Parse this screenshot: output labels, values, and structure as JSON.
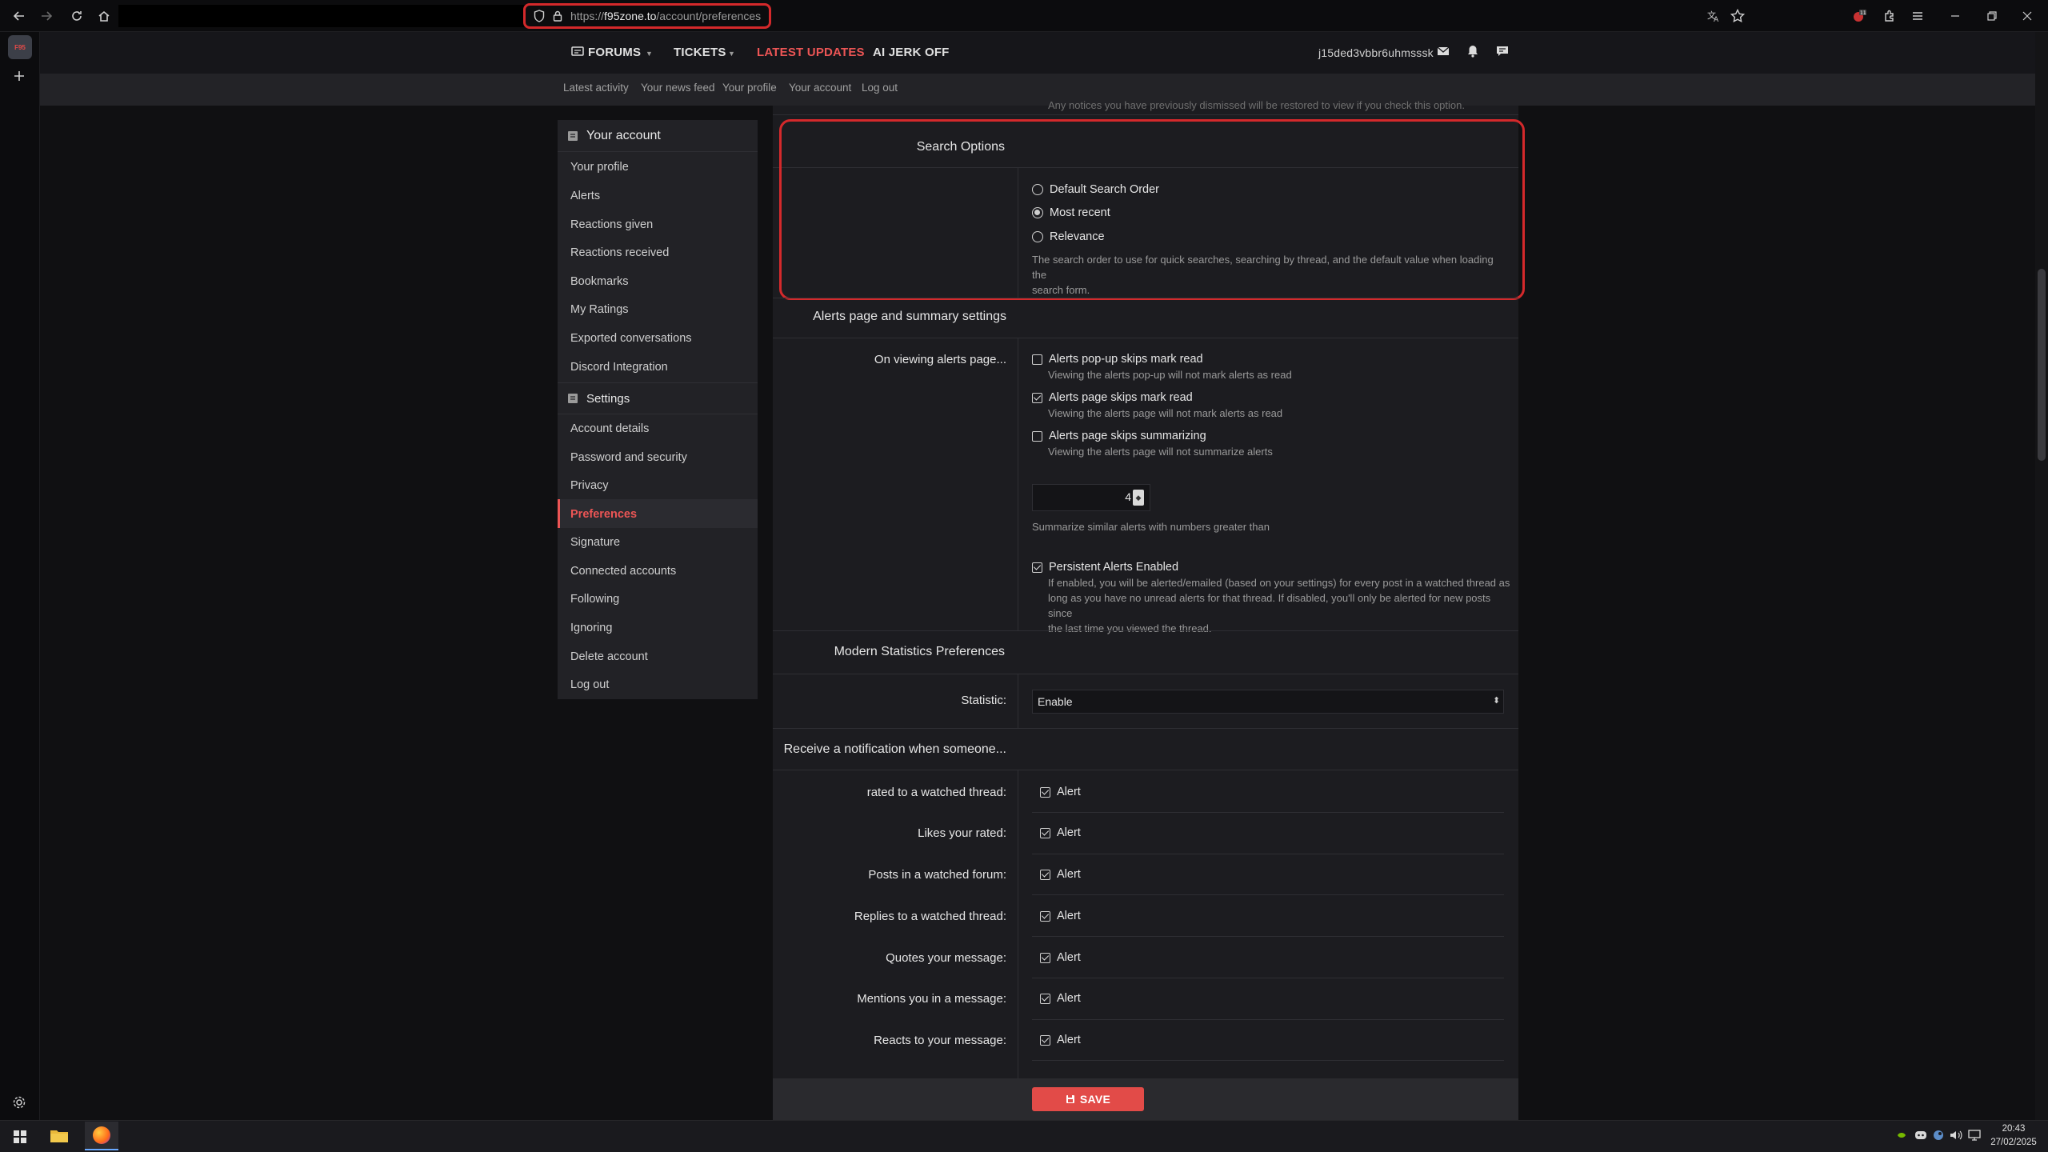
{
  "browser": {
    "url_prefix": "https://",
    "url_host": "f95zone.to",
    "url_path": "/account/preferences"
  },
  "site": {
    "logo_text": "F95",
    "nav": {
      "forums": "FORUMS",
      "tickets": "TICKETS",
      "latest_updates": "LATEST UPDATES",
      "ai_jerk_off": "AI JERK OFF",
      "username": "j15ded3vbbr6uhmsssk"
    },
    "subnav": [
      "Latest activity",
      "Your news feed",
      "Your profile",
      "Your account",
      "Log out"
    ]
  },
  "account_menu": {
    "section1_title": "Your account",
    "section1_items": [
      "Your profile",
      "Alerts",
      "Reactions given",
      "Reactions received",
      "Bookmarks",
      "My Ratings",
      "Exported conversations",
      "Discord Integration"
    ],
    "section2_title": "Settings",
    "section2_items": [
      "Account details",
      "Password and security",
      "Privacy",
      "Preferences",
      "Signature",
      "Connected accounts",
      "Following",
      "Ignoring",
      "Delete account",
      "Log out"
    ]
  },
  "form": {
    "top_note": "Any notices you have previously dismissed will be restored to view if you check this option.",
    "search": {
      "title": "Search Options",
      "options": [
        "Default Search Order",
        "Most recent",
        "Relevance"
      ],
      "selected_index": 1,
      "hint_line1": "The search order to use for quick searches, searching by thread, and the default value when loading the",
      "hint_line2": "search form."
    },
    "alerts": {
      "title": "Alerts page and summary settings",
      "label": "On viewing alerts page...",
      "popup_label": "Alerts pop-up skips mark read",
      "popup_hint": "Viewing the alerts pop-up will not mark alerts as read",
      "popup_checked": false,
      "page_label": "Alerts page skips mark read",
      "page_hint": "Viewing the alerts page will not mark alerts as read",
      "page_checked": true,
      "summ_label": "Alerts page skips summarizing",
      "summ_hint": "Viewing the alerts page will not summarize alerts",
      "summ_checked": false,
      "threshold_value": "4",
      "threshold_hint": "Summarize similar alerts with numbers greater than",
      "persistent_label": "Persistent Alerts Enabled",
      "persistent_hint_1": "If enabled, you will be alerted/emailed (based on your settings) for every post in a watched thread as",
      "persistent_hint_2": "long as you have no unread alerts for that thread. If disabled, you'll only be alerted for new posts since",
      "persistent_hint_3": "the last time you viewed the thread.",
      "persistent_checked": true
    },
    "stats": {
      "title": "Modern Statistics Preferences",
      "label": "Statistic:",
      "value": "Enable"
    },
    "notify": {
      "title": "Receive a notification when someone...",
      "alert_text": "Alert",
      "rows": [
        "rated to a watched thread:",
        "Likes your rated:",
        "Posts in a watched forum:",
        "Replies to a watched thread:",
        "Quotes your message:",
        "Mentions you in a message:",
        "Reacts to your message:"
      ]
    },
    "save_label": "SAVE"
  },
  "taskbar": {
    "time": "20:43",
    "date": "27/02/2025"
  },
  "colors": {
    "accent": "#e24b48",
    "highlight": "#d4292b"
  }
}
